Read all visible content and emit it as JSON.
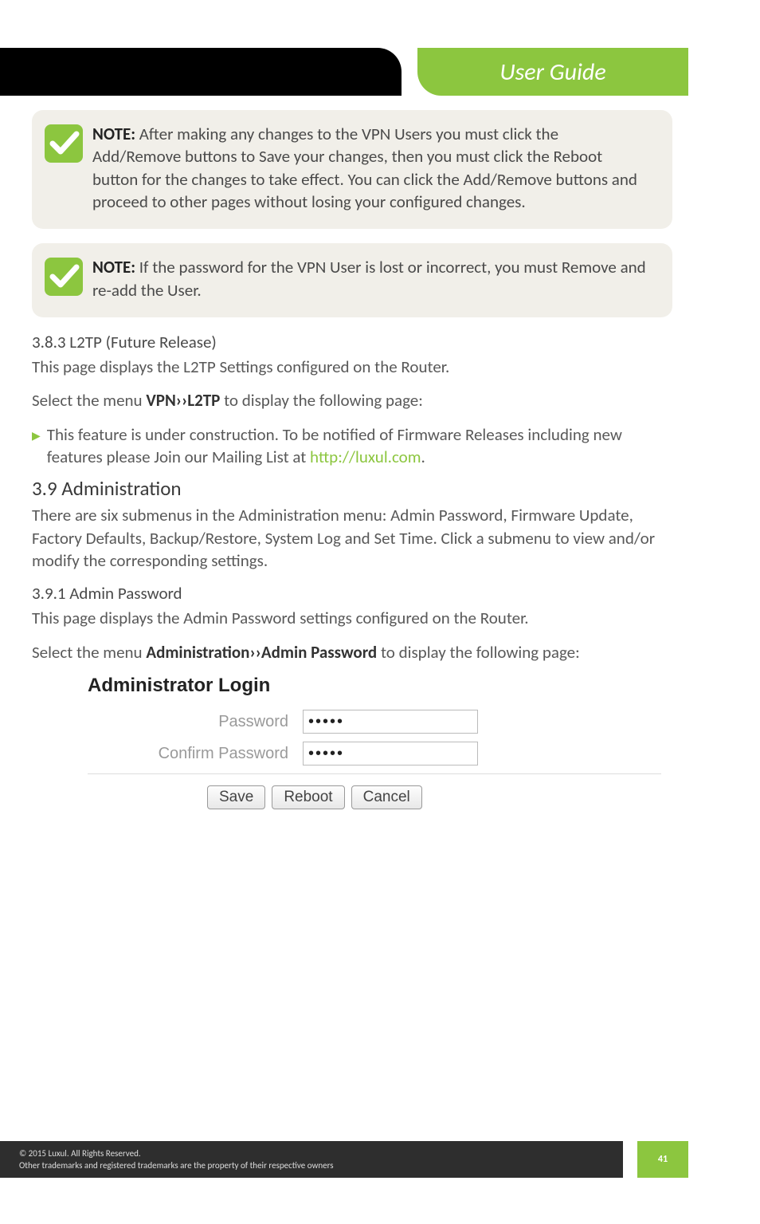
{
  "header": {
    "title": "User Guide"
  },
  "notes": [
    {
      "label": "NOTE:",
      "text": "After making any changes to the VPN Users you must click the Add/Remove buttons to Save your changes, then you must click the Reboot button for the changes to take effect. You can click the Add/Remove buttons and proceed to other pages without losing your configured changes."
    },
    {
      "label": "NOTE:",
      "text": "If the password for the VPN User is lost or incorrect, you must Remove and re-add the User."
    }
  ],
  "section_383": {
    "heading": "3.8.3 L2TP (Future Release)",
    "p1": "This page displays the L2TP Settings configured on the Router.",
    "p2_pre": "Select the menu ",
    "p2_bold": "VPN››L2TP",
    "p2_post": " to display the following page:",
    "bullet_pre": "This feature is under construction. To be notified of Firmware Releases including new features please Join our Mailing List at ",
    "bullet_link": "http://luxul.com",
    "bullet_post": "."
  },
  "section_39": {
    "heading": "3.9 Administration",
    "p": "There are six submenus in the Administration menu: Admin Password, Firmware Update, Factory Defaults, Backup/Restore, System Log and Set Time. Click a submenu to view and/or modify the corresponding settings."
  },
  "section_391": {
    "heading": "3.9.1 Admin Password",
    "p1": "This page displays the Admin Password settings configured on the Router.",
    "p2_pre": "Select the menu ",
    "p2_bold": "Administration››Admin Password",
    "p2_post": " to display the following page:"
  },
  "admin_login": {
    "title": "Administrator Login",
    "password_label": "Password",
    "password_value": "•••••",
    "confirm_label": "Confirm Password",
    "confirm_value": "•••••",
    "buttons": {
      "save": "Save",
      "reboot": "Reboot",
      "cancel": "Cancel"
    }
  },
  "footer": {
    "line1": "© 2015  Luxul. All Rights Reserved.",
    "line2": "Other trademarks and registered trademarks are the property of their respective owners",
    "page": "41"
  },
  "colors": {
    "accent_green": "#8cc63f"
  }
}
